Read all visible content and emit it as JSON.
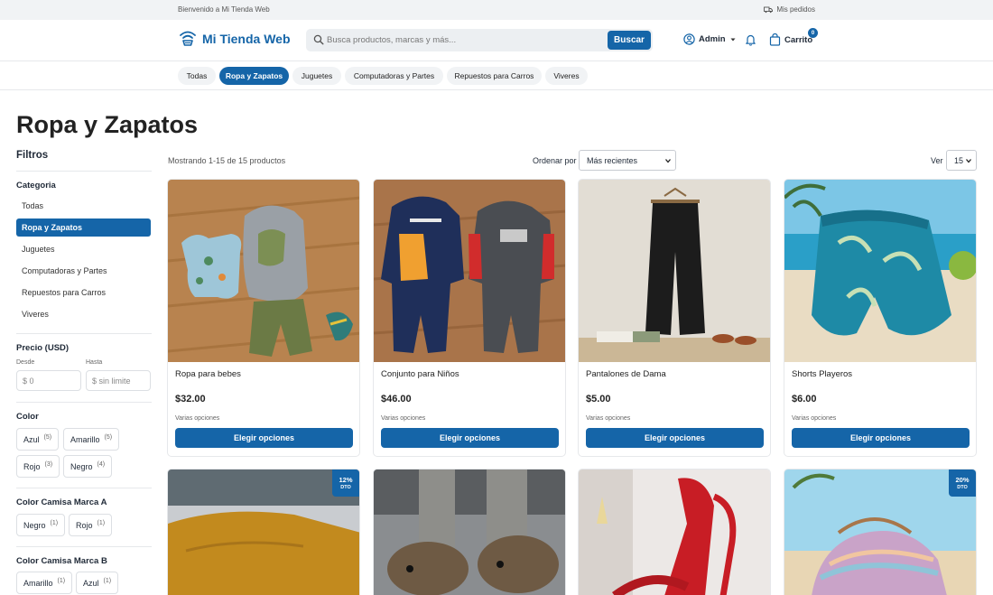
{
  "topbar": {
    "welcome": "Bienvenido a Mi Tienda Web",
    "orders": "Mis pedidos"
  },
  "header": {
    "brand": "Mi Tienda Web",
    "search_placeholder": "Busca productos, marcas y más...",
    "search_button": "Buscar",
    "user": "Admin",
    "cart_label": "Carrito",
    "cart_count": "0"
  },
  "nav": {
    "categories": [
      "Todas",
      "Ropa y Zapatos",
      "Juguetes",
      "Computadoras y Partes",
      "Repuestos para Carros",
      "Viveres"
    ],
    "active_index": 1
  },
  "page_title": "Ropa y Zapatos",
  "filters": {
    "heading": "Filtros",
    "category_title": "Categoria",
    "categories": [
      "Todas",
      "Ropa y Zapatos",
      "Juguetes",
      "Computadoras y Partes",
      "Repuestos para Carros",
      "Viveres"
    ],
    "price_title": "Precio (USD)",
    "from_label": "Desde",
    "to_label": "Hasta",
    "from_placeholder": "$ 0",
    "to_placeholder": "$ sin limite",
    "color_title": "Color",
    "colors": [
      {
        "name": "Azul",
        "count": "(5)"
      },
      {
        "name": "Amarillo",
        "count": "(5)"
      },
      {
        "name": "Rojo",
        "count": "(3)"
      },
      {
        "name": "Negro",
        "count": "(4)"
      }
    ],
    "shirt_a_title": "Color Camisa Marca A",
    "shirt_a": [
      {
        "name": "Negro",
        "count": "(1)"
      },
      {
        "name": "Rojo",
        "count": "(1)"
      }
    ],
    "shirt_b_title": "Color Camisa Marca B",
    "shirt_b": [
      {
        "name": "Amarillo",
        "count": "(1)"
      },
      {
        "name": "Azul",
        "count": "(1)"
      }
    ]
  },
  "results": {
    "showing": "Mostrando 1-15 de 15 productos",
    "order_label": "Ordenar por",
    "order_value": "Más recientes",
    "view_label": "Ver",
    "view_value": "15"
  },
  "products": [
    {
      "name": "Ropa para bebes",
      "price": "$32.00",
      "options": "Varias opciones",
      "button": "Elegir opciones"
    },
    {
      "name": "Conjunto para Niños",
      "price": "$46.00",
      "options": "Varias opciones",
      "button": "Elegir opciones"
    },
    {
      "name": "Pantalones de Dama",
      "price": "$5.00",
      "options": "Varias opciones",
      "button": "Elegir opciones"
    },
    {
      "name": "Shorts Playeros",
      "price": "$6.00",
      "options": "Varias opciones",
      "button": "Elegir opciones"
    }
  ],
  "badges": [
    {
      "pct": "12%",
      "label": "DTO"
    },
    {
      "pct": "20%",
      "label": "DTO"
    }
  ],
  "colors": {
    "accent": "#1565a8",
    "pill_bg": "#f1f3f5"
  }
}
